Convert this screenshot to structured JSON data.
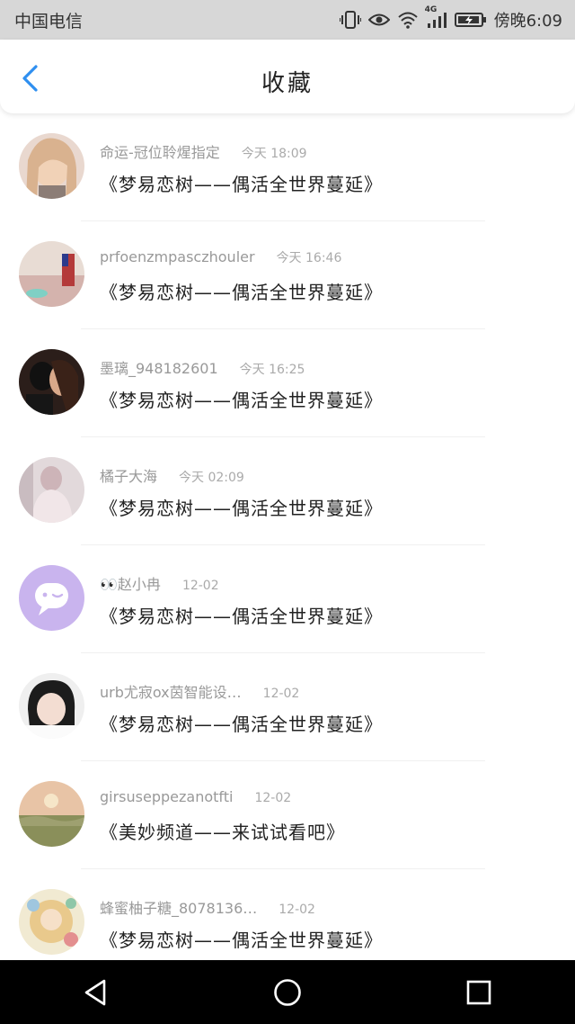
{
  "status_bar": {
    "carrier": "中国电信",
    "network": "4G",
    "time": "傍晚6:09"
  },
  "header": {
    "title": "收藏",
    "back_icon": "chevron-left-icon",
    "accent_color": "#2f8ff0"
  },
  "favorites": [
    {
      "name": "命运-冠位聆煋指定",
      "time": "今天 18:09",
      "message": "《梦易恋树——偶活全世界蔓延》"
    },
    {
      "name": "prfoenzmpasczhouler",
      "time": "今天 16:46",
      "message": "《梦易恋树——偶活全世界蔓延》"
    },
    {
      "name": "墨璃_948182601",
      "time": "今天 16:25",
      "message": "《梦易恋树——偶活全世界蔓延》"
    },
    {
      "name": "橘子大海",
      "time": "今天 02:09",
      "message": "《梦易恋树——偶活全世界蔓延》"
    },
    {
      "name": "👀赵小冉",
      "time": "12-02",
      "message": "《梦易恋树——偶活全世界蔓延》"
    },
    {
      "name": "urb尤寂ox茵智能设…",
      "time": "12-02",
      "message": "《梦易恋树——偶活全世界蔓延》"
    },
    {
      "name": "girsuseppezanotfti",
      "time": "12-02",
      "message": "《美妙频道——来试试看吧》"
    },
    {
      "name": "蜂蜜柚子糖_8078136…",
      "time": "12-02",
      "message": "《梦易恋树——偶活全世界蔓延》"
    }
  ],
  "bottom_nav": {
    "back_icon": "triangle-back-icon",
    "home_icon": "circle-home-icon",
    "recents_icon": "square-recents-icon"
  }
}
